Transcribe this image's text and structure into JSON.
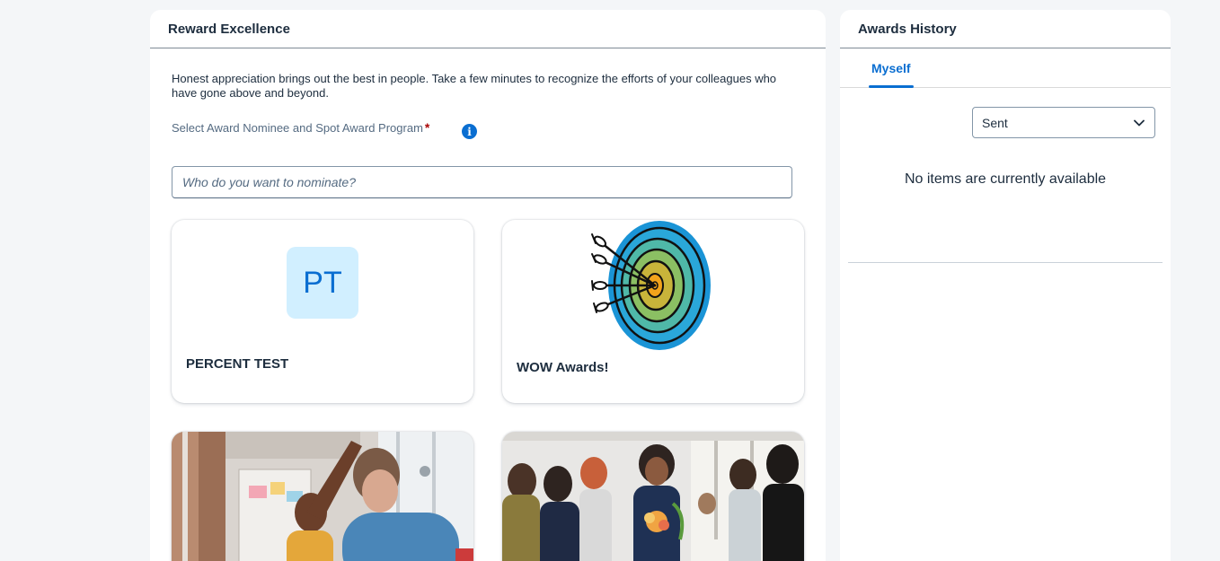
{
  "reward": {
    "title": "Reward Excellence",
    "intro": "Honest appreciation brings out the best in people. Take a few minutes to recognize the efforts of your colleagues who have gone above and beyond.",
    "field_label": "Select Award Nominee and Spot Award Program",
    "required_mark": "*",
    "info_icon": "info-icon",
    "nominee_placeholder": "Who do you want to nominate?",
    "programs": [
      {
        "initials": "PT",
        "title": "PERCENT TEST"
      },
      {
        "title": "WOW Awards!",
        "icon": "target-arrows-icon"
      },
      {
        "image": "team-high-five-photo"
      },
      {
        "image": "team-applause-photo"
      }
    ]
  },
  "history": {
    "title": "Awards History",
    "tabs": [
      {
        "label": "Myself",
        "selected": true
      }
    ],
    "filter_value": "Sent",
    "empty_text": "No items are currently available"
  },
  "colors": {
    "accent": "#0a6ed1",
    "avatar_bg": "#d1efff",
    "required": "#aa0808"
  }
}
